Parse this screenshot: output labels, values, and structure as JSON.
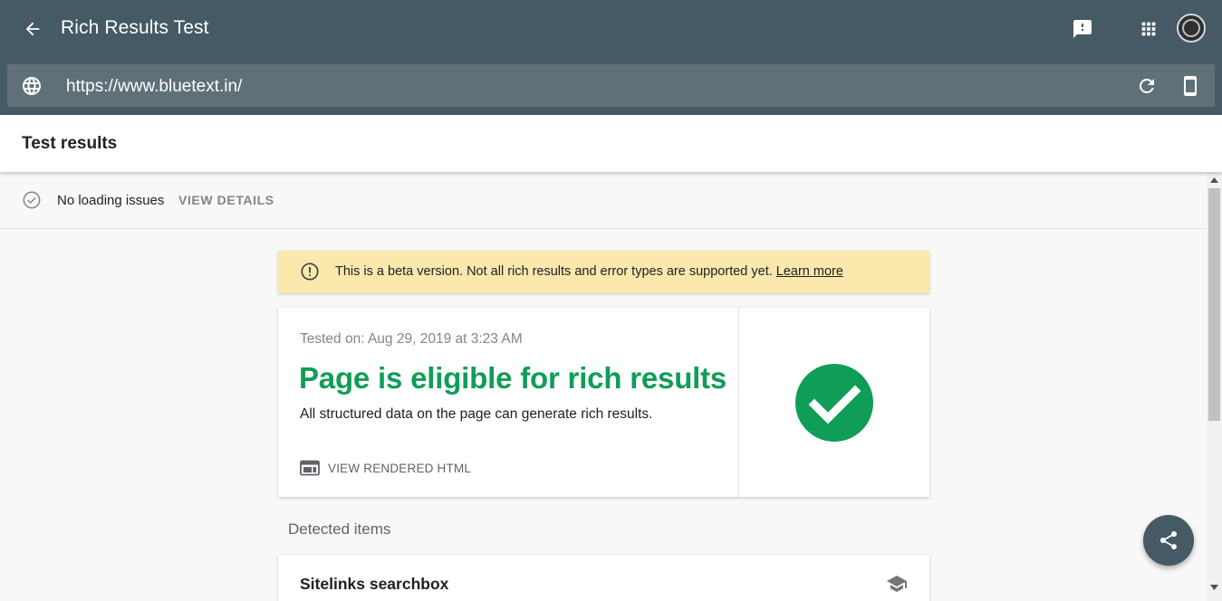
{
  "app": {
    "title": "Rich Results Test"
  },
  "urlbar": {
    "url": "https://www.bluetext.in/"
  },
  "results": {
    "title": "Test results"
  },
  "loading": {
    "status": "No loading issues",
    "details_label": "VIEW DETAILS"
  },
  "banner": {
    "message": "This is a beta version. Not all rich results and error types are supported yet.",
    "link_label": "Learn more"
  },
  "summary": {
    "tested_on": "Tested on: Aug 29, 2019 at 3:23 AM",
    "headline": "Page is eligible for rich results",
    "description": "All structured data on the page can generate rich results.",
    "view_html_label": "VIEW RENDERED HTML"
  },
  "detected": {
    "heading": "Detected items",
    "items": [
      {
        "title": "Sitelinks searchbox",
        "icon": "school-icon"
      }
    ]
  },
  "icons": {
    "back": "arrow-back-icon",
    "feedback": "feedback-icon",
    "apps": "apps-grid-icon",
    "globe": "globe-icon",
    "refresh": "refresh-icon",
    "device": "smartphone-icon",
    "share": "share-icon"
  },
  "colors": {
    "header": "#455a64",
    "urlbar": "#607079",
    "success": "#0f9d58",
    "banner": "#fbe8ad"
  }
}
